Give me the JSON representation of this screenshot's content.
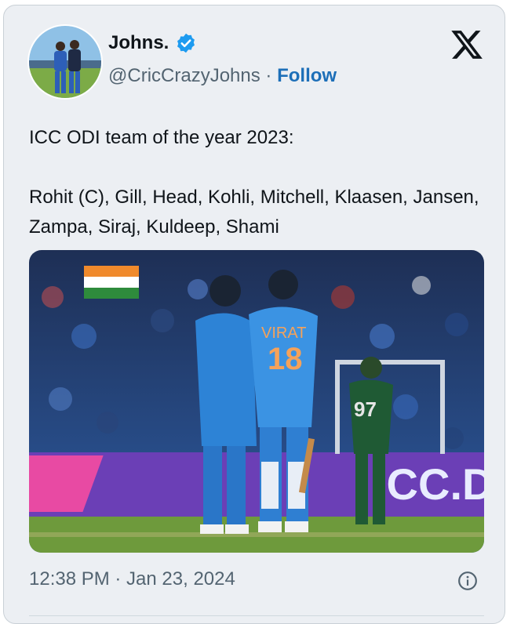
{
  "tweet": {
    "author_name": "Johns.",
    "author_handle": "@CricCrazyJohns",
    "separator": "·",
    "follow_label": "Follow",
    "text": "ICC ODI team of the year 2023:\n\nRohit (C), Gill, Head, Kohli, Mitchell, Klaasen, Jansen, Zampa, Siraj, Kuldeep, Shami",
    "timestamp": "12:38 PM · Jan 23, 2024"
  },
  "media": {
    "jersey_name": "VIRAT",
    "jersey_number": "18",
    "opponent_number": "97",
    "board_text": "ICC.DR"
  },
  "icons": {
    "verified": "verified-badge-icon",
    "brand": "x-logo-icon",
    "info": "info-icon"
  },
  "colors": {
    "card_bg": "#eceff3",
    "follow": "#1d6fb8",
    "verified": "#1d9bf0",
    "india_blue": "#2d83d6",
    "pitch_green": "#6e9a3c",
    "board_purple": "#6b3fb6"
  }
}
